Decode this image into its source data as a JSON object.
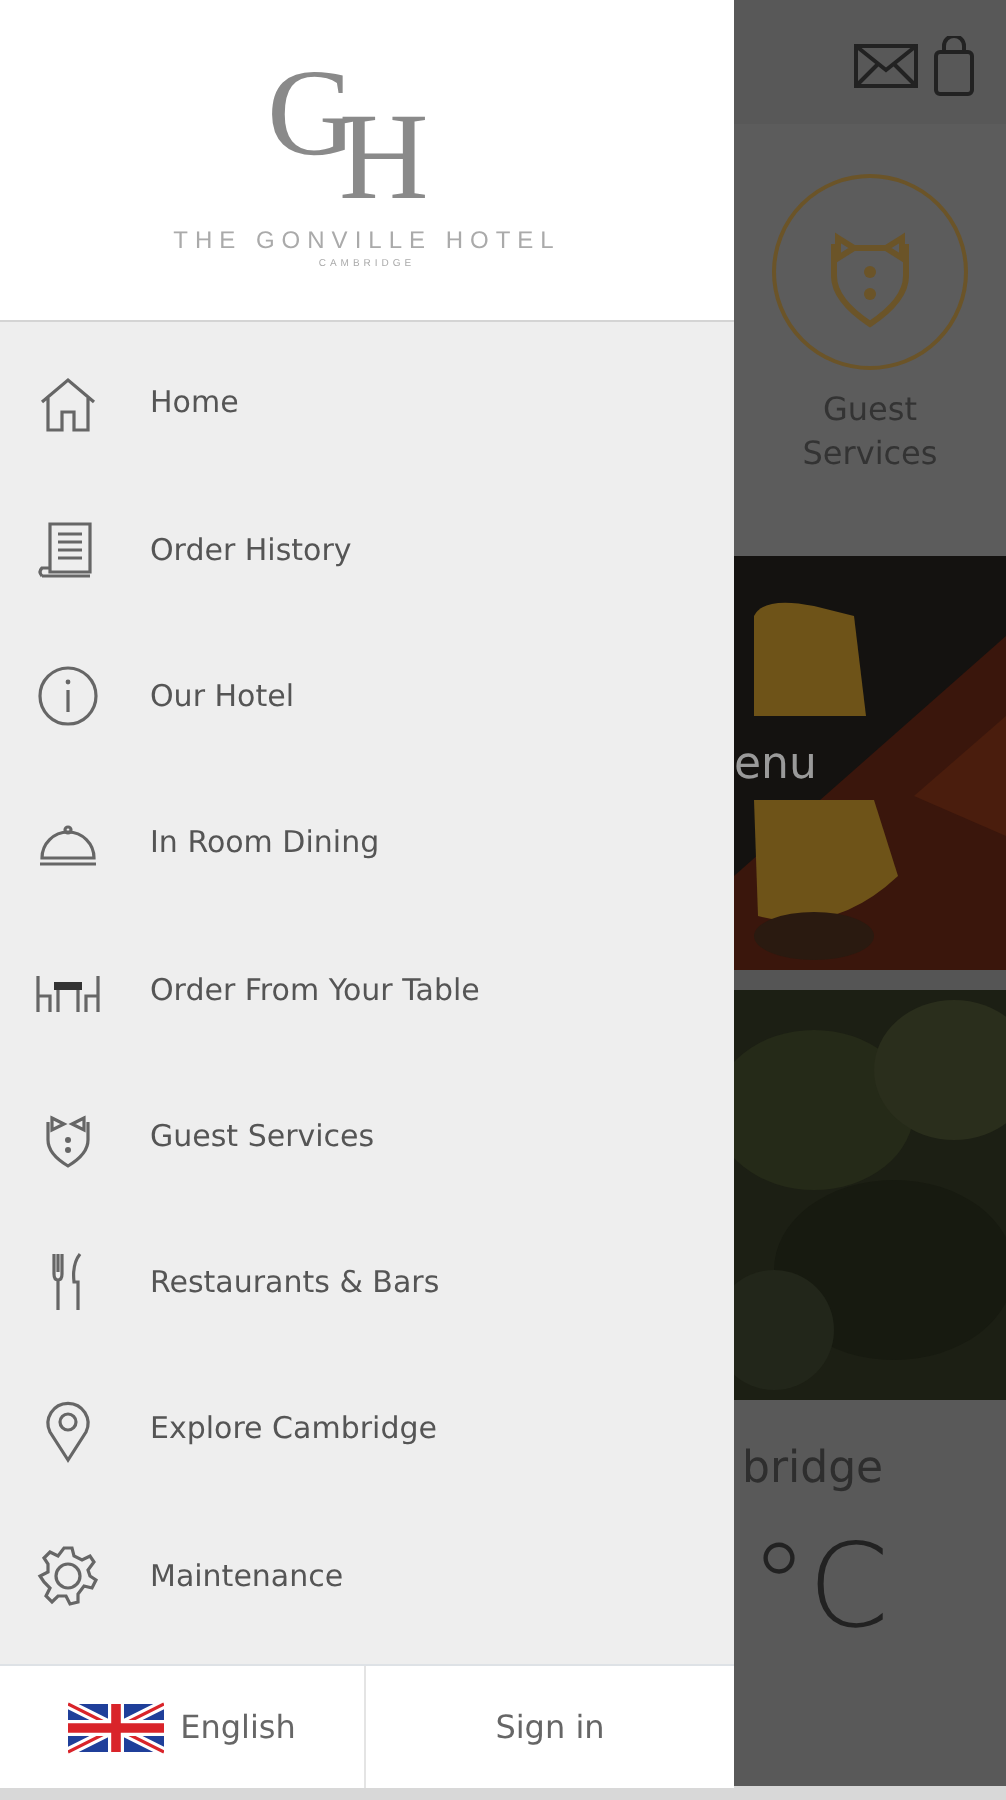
{
  "logo": {
    "monogram_first": "G",
    "monogram_second": "H",
    "name": "THE GONVILLE HOTEL",
    "city": "CAMBRIDGE"
  },
  "menu": [
    {
      "label": "Home",
      "kind": "home"
    },
    {
      "label": "Order History",
      "kind": "receipt"
    },
    {
      "label": "Our Hotel",
      "kind": "info"
    },
    {
      "label": "In Room Dining",
      "kind": "cloche"
    },
    {
      "label": "Order From Your Table",
      "kind": "table"
    },
    {
      "label": "Guest Services",
      "kind": "tuxedo"
    },
    {
      "label": "Restaurants & Bars",
      "kind": "cutlery"
    },
    {
      "label": "Explore Cambridge",
      "kind": "pin"
    },
    {
      "label": "Maintenance",
      "kind": "gear"
    }
  ],
  "footer": {
    "language": "English",
    "sign_in": "Sign in"
  },
  "background": {
    "tile_label": "Guest Services",
    "photo_caption": "enu",
    "weather_city": "bridge",
    "temperature": "°C"
  }
}
